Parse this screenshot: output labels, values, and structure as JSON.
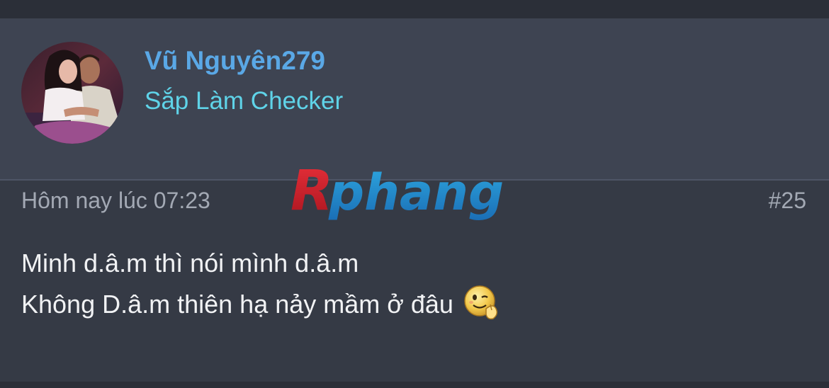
{
  "post": {
    "username": "Vũ Nguyên279",
    "user_title": "Sắp Làm Checker",
    "timestamp": "Hôm nay lúc 07:23",
    "post_number": "#25",
    "lines": [
      "Minh d.â.m thì nói mình d.â.m",
      "Không D.â.m thiên hạ nảy mầm ở đâu"
    ]
  },
  "watermark": {
    "text": "Rphang"
  },
  "icons": {
    "smiley": "wink-thumbs-up-smiley-icon"
  },
  "colors": {
    "background": "#2b2f38",
    "header": "#3e4452",
    "username": "#5aa8e6",
    "user_title": "#5fd3e8",
    "meta_text": "#a3a9b4",
    "body_text": "#f1f2f4"
  }
}
